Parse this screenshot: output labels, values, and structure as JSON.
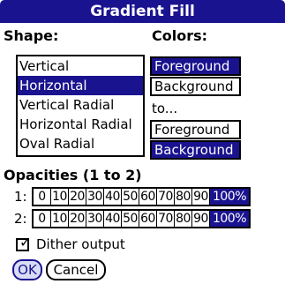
{
  "dialog": {
    "title": "Gradient Fill"
  },
  "shape": {
    "heading": "Shape:",
    "items": [
      {
        "label": "Vertical",
        "selected": false
      },
      {
        "label": "Horizontal",
        "selected": true
      },
      {
        "label": "Vertical Radial",
        "selected": false
      },
      {
        "label": "Horizontal Radial",
        "selected": false
      },
      {
        "label": "Oval Radial",
        "selected": false
      }
    ]
  },
  "colors": {
    "heading": "Colors:",
    "from_foreground": "Foreground",
    "from_background": "Background",
    "to_label": "to...",
    "to_foreground": "Foreground",
    "to_background": "Background"
  },
  "opacities": {
    "heading": "Opacities (1 to 2)",
    "rows": [
      {
        "label": "1:",
        "values": [
          "0",
          "10",
          "20",
          "30",
          "40",
          "50",
          "60",
          "70",
          "80",
          "90",
          "100%"
        ],
        "selected_index": 10
      },
      {
        "label": "2:",
        "values": [
          "0",
          "10",
          "20",
          "30",
          "40",
          "50",
          "60",
          "70",
          "80",
          "90",
          "100%"
        ],
        "selected_index": 10
      }
    ]
  },
  "dither": {
    "label": "Dither output",
    "checked": true
  },
  "buttons": {
    "ok": "OK",
    "cancel": "Cancel"
  },
  "theme": {
    "accent": "#1a1390",
    "ok_bg": "#d8ddf5"
  }
}
